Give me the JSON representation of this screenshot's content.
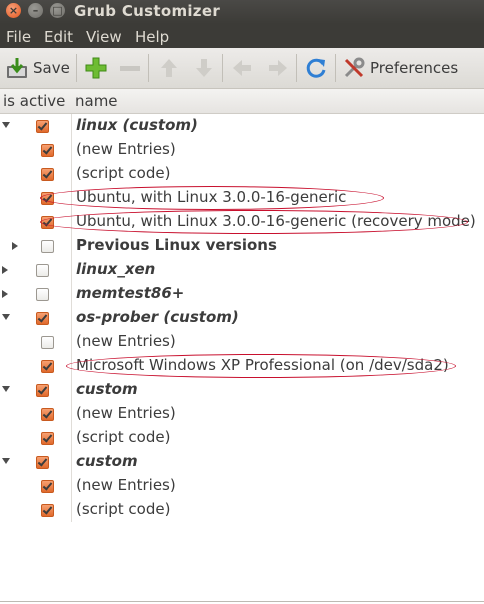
{
  "window": {
    "title": "Grub Customizer"
  },
  "menu": [
    "File",
    "Edit",
    "View",
    "Help"
  ],
  "toolbar": {
    "save_label": "Save",
    "preferences_label": "Preferences"
  },
  "columns": {
    "active": "is active",
    "name": "name"
  },
  "rows": [
    {
      "label": "linux (custom)",
      "style": "bi",
      "checked": true,
      "expander": "open",
      "indent": 0
    },
    {
      "label": "(new Entries)",
      "style": "",
      "checked": true,
      "expander": "",
      "indent": 1
    },
    {
      "label": "(script code)",
      "style": "",
      "checked": true,
      "expander": "",
      "indent": 1
    },
    {
      "label": "Ubuntu, with Linux 3.0.0-16-generic",
      "style": "",
      "checked": true,
      "expander": "",
      "indent": 1,
      "highlight": true
    },
    {
      "label": "Ubuntu, with Linux 3.0.0-16-generic (recovery mode)",
      "style": "",
      "checked": true,
      "expander": "",
      "indent": 1,
      "highlight": true
    },
    {
      "label": "Previous Linux versions",
      "style": "b",
      "checked": false,
      "expander": "closed",
      "indent": 1
    },
    {
      "label": "linux_xen",
      "style": "bi",
      "checked": false,
      "expander": "closed",
      "indent": 0
    },
    {
      "label": "memtest86+",
      "style": "bi",
      "checked": false,
      "expander": "closed",
      "indent": 0
    },
    {
      "label": "os-prober (custom)",
      "style": "bi",
      "checked": true,
      "expander": "open",
      "indent": 0
    },
    {
      "label": "(new Entries)",
      "style": "",
      "checked": false,
      "expander": "",
      "indent": 1
    },
    {
      "label": "Microsoft Windows XP Professional (on /dev/sda2)",
      "style": "",
      "checked": true,
      "expander": "",
      "indent": 1,
      "highlight": true
    },
    {
      "label": "custom",
      "style": "bi",
      "checked": true,
      "expander": "open",
      "indent": 0
    },
    {
      "label": "(new Entries)",
      "style": "",
      "checked": true,
      "expander": "",
      "indent": 1
    },
    {
      "label": "(script code)",
      "style": "",
      "checked": true,
      "expander": "",
      "indent": 1
    },
    {
      "label": "custom",
      "style": "bi",
      "checked": true,
      "expander": "open",
      "indent": 0
    },
    {
      "label": "(new Entries)",
      "style": "",
      "checked": true,
      "expander": "",
      "indent": 1
    },
    {
      "label": "(script code)",
      "style": "",
      "checked": true,
      "expander": "",
      "indent": 1
    }
  ],
  "colors": {
    "accent": "#e06a2c",
    "titlebar": "#3c3b37",
    "highlight_ring": "#c8102e"
  }
}
